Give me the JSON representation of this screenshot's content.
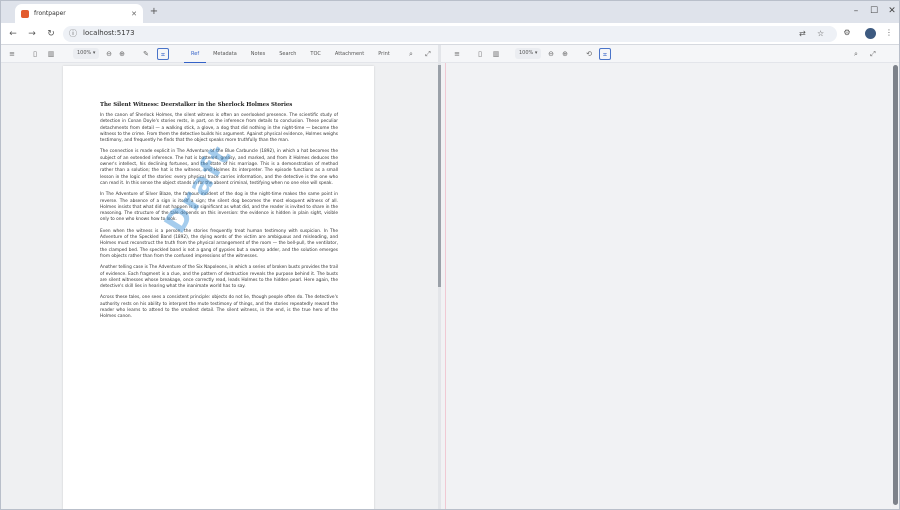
{
  "browser": {
    "tab_title": "frontpaper",
    "url": "localhost:5173"
  },
  "viewer": {
    "zoom_left": "100%",
    "zoom_right": "100%",
    "tabs": [
      {
        "label": "Ref"
      },
      {
        "label": "Metadata"
      },
      {
        "label": "Notes"
      },
      {
        "label": "Search"
      },
      {
        "label": "TOC"
      },
      {
        "label": "Attachment"
      },
      {
        "label": "Print"
      }
    ]
  },
  "document": {
    "title": "The Silent Witness: Deerstalker in the Sherlock Holmes Stories",
    "paragraphs": [
      "In the canon of Sherlock Holmes, the silent witness is often an overlooked presence. The scientific study of detection in Conan Doyle's stories rests, in part, on the inference from details to conclusion. These peculiar detachments from detail — a walking stick, a glove, a dog that did nothing in the night-time — become the witness to the crime. From them the detective builds his argument. Against physical evidence, Holmes weighs testimony, and frequently he finds that the object speaks more truthfully than the man.",
      "The connection is made explicit in The Adventure of the Blue Carbuncle (1892), in which a hat becomes the subject of an extended inference. The hat is battered, greasy, and marked, and from it Holmes deduces the owner's intellect, his declining fortunes, and the state of his marriage. This is a demonstration of method rather than a solution; the hat is the witness, and Holmes its interpreter. The episode functions as a small lesson in the logic of the stories: every physical trace carries information, and the detective is the one who can read it. In this sense the object stands in for the absent criminal, testifying when no one else will speak.",
      "In The Adventure of Silver Blaze, the famous incident of the dog in the night-time makes the same point in reverse. The absence of a sign is itself a sign; the silent dog becomes the most eloquent witness of all. Holmes insists that what did not happen is as significant as what did, and the reader is invited to share in the reasoning. The structure of the tale depends on this inversion: the evidence is hidden in plain sight, visible only to one who knows how to look.",
      "Even when the witness is a person, the stories frequently treat human testimony with suspicion. In The Adventure of the Speckled Band (1892), the dying words of the victim are ambiguous and misleading, and Holmes must reconstruct the truth from the physical arrangement of the room — the bell-pull, the ventilator, the clamped bed. The speckled band is not a gang of gypsies but a swamp adder, and the solution emerges from objects rather than from the confused impressions of the witnesses.",
      "Another telling case is The Adventure of the Six Napoleons, in which a series of broken busts provides the trail of evidence. Each fragment is a clue, and the pattern of destruction reveals the purpose behind it. The busts are silent witnesses whose breakage, once correctly read, leads Holmes to the hidden pearl. Here again, the detective's skill lies in hearing what the inanimate world has to say.",
      "Across these tales, one sees a consistent principle: objects do not lie, though people often do. The detective's authority rests on his ability to interpret the mute testimony of things, and the stories repeatedly reward the reader who learns to attend to the smallest detail. The silent witness, in the end, is the true hero of the Holmes canon."
    ],
    "watermark": "Draft"
  }
}
